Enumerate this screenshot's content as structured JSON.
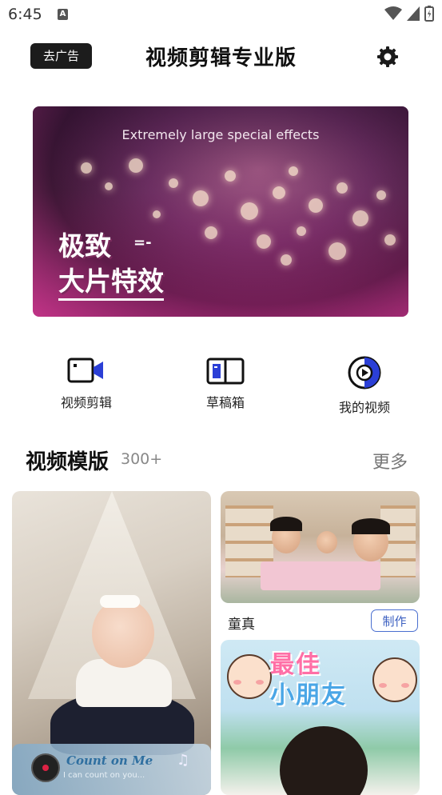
{
  "status_bar": {
    "time": "6:45",
    "notification_icon": "a-icon"
  },
  "header": {
    "ad_button": "去广告",
    "title": "视频剪辑专业版",
    "settings_icon": "gear-icon"
  },
  "banner": {
    "tagline": "Extremely large special effects",
    "line1": "极致",
    "line2": "大片特效",
    "accent_colors": [
      "#6d2f62",
      "#c23c8a"
    ]
  },
  "actions": [
    {
      "label": "视频剪辑",
      "icon": "video-camera-icon"
    },
    {
      "label": "草稿箱",
      "icon": "drafts-book-icon"
    },
    {
      "label": "我的视频",
      "icon": "play-circle-icon"
    }
  ],
  "section": {
    "title": "视频模版",
    "count": "300+",
    "more": "更多"
  },
  "cards": {
    "left": {
      "music_title": "Count on Me",
      "music_subtitle": "I can count on you..."
    },
    "right_top": {
      "label": "童真",
      "button": "制作"
    },
    "right_bottom": {
      "poster_line1": "最佳",
      "poster_line2": "小朋友"
    }
  },
  "colors": {
    "button_border": "#4a6fd0",
    "ad_button_bg": "#1c1c1c"
  }
}
